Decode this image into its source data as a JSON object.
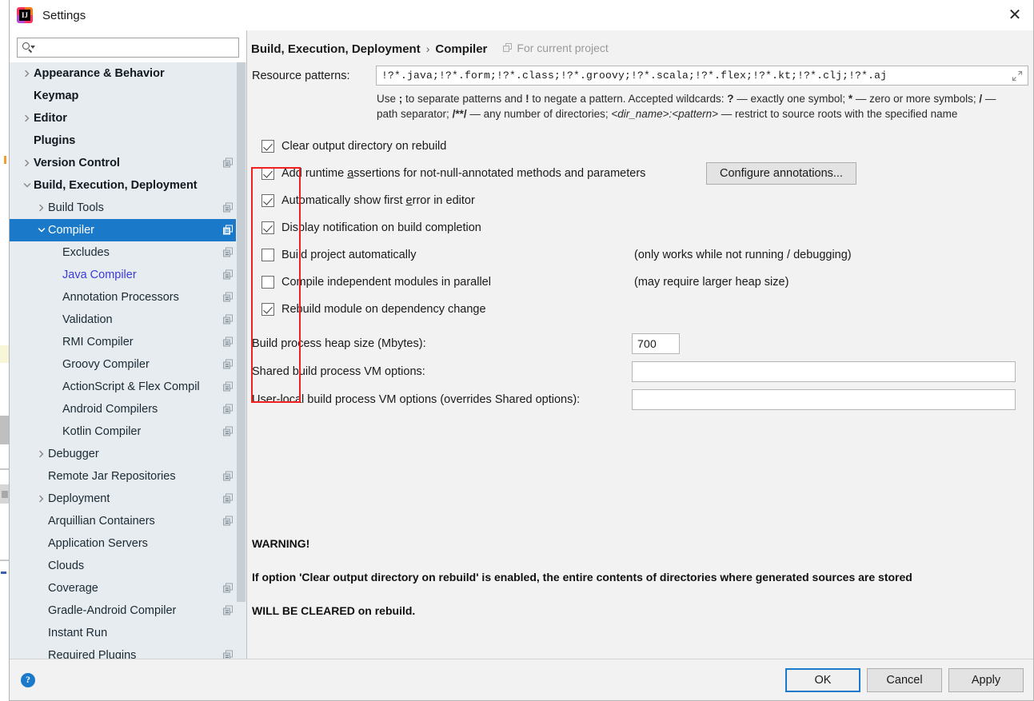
{
  "window": {
    "title": "Settings",
    "app_icon": "intellij-idea-logo",
    "close_label": "✕"
  },
  "search": {
    "value": "",
    "placeholder": ""
  },
  "sidebar": {
    "items": [
      {
        "label": "Appearance & Behavior",
        "level": 0,
        "twisty": "right",
        "bold": true,
        "copy": false,
        "selected": false,
        "link": false
      },
      {
        "label": "Keymap",
        "level": 0,
        "twisty": "none",
        "bold": true,
        "copy": false,
        "selected": false,
        "link": false
      },
      {
        "label": "Editor",
        "level": 0,
        "twisty": "right",
        "bold": true,
        "copy": false,
        "selected": false,
        "link": false
      },
      {
        "label": "Plugins",
        "level": 0,
        "twisty": "none",
        "bold": true,
        "copy": false,
        "selected": false,
        "link": false
      },
      {
        "label": "Version Control",
        "level": 0,
        "twisty": "right",
        "bold": true,
        "copy": true,
        "selected": false,
        "link": false
      },
      {
        "label": "Build, Execution, Deployment",
        "level": 0,
        "twisty": "down",
        "bold": true,
        "copy": false,
        "selected": false,
        "link": false
      },
      {
        "label": "Build Tools",
        "level": 1,
        "twisty": "right",
        "bold": false,
        "copy": true,
        "selected": false,
        "link": false
      },
      {
        "label": "Compiler",
        "level": 1,
        "twisty": "down",
        "bold": false,
        "copy": true,
        "selected": true,
        "link": false
      },
      {
        "label": "Excludes",
        "level": 2,
        "twisty": "none",
        "bold": false,
        "copy": true,
        "selected": false,
        "link": false
      },
      {
        "label": "Java Compiler",
        "level": 2,
        "twisty": "none",
        "bold": false,
        "copy": true,
        "selected": false,
        "link": true
      },
      {
        "label": "Annotation Processors",
        "level": 2,
        "twisty": "none",
        "bold": false,
        "copy": true,
        "selected": false,
        "link": false
      },
      {
        "label": "Validation",
        "level": 2,
        "twisty": "none",
        "bold": false,
        "copy": true,
        "selected": false,
        "link": false
      },
      {
        "label": "RMI Compiler",
        "level": 2,
        "twisty": "none",
        "bold": false,
        "copy": true,
        "selected": false,
        "link": false
      },
      {
        "label": "Groovy Compiler",
        "level": 2,
        "twisty": "none",
        "bold": false,
        "copy": true,
        "selected": false,
        "link": false
      },
      {
        "label": "ActionScript & Flex Compil",
        "level": 2,
        "twisty": "none",
        "bold": false,
        "copy": true,
        "selected": false,
        "link": false
      },
      {
        "label": "Android Compilers",
        "level": 2,
        "twisty": "none",
        "bold": false,
        "copy": true,
        "selected": false,
        "link": false
      },
      {
        "label": "Kotlin Compiler",
        "level": 2,
        "twisty": "none",
        "bold": false,
        "copy": true,
        "selected": false,
        "link": false
      },
      {
        "label": "Debugger",
        "level": 1,
        "twisty": "right",
        "bold": false,
        "copy": false,
        "selected": false,
        "link": false
      },
      {
        "label": "Remote Jar Repositories",
        "level": 1,
        "twisty": "none",
        "bold": false,
        "copy": true,
        "selected": false,
        "link": false
      },
      {
        "label": "Deployment",
        "level": 1,
        "twisty": "right",
        "bold": false,
        "copy": true,
        "selected": false,
        "link": false
      },
      {
        "label": "Arquillian Containers",
        "level": 1,
        "twisty": "none",
        "bold": false,
        "copy": true,
        "selected": false,
        "link": false
      },
      {
        "label": "Application Servers",
        "level": 1,
        "twisty": "none",
        "bold": false,
        "copy": false,
        "selected": false,
        "link": false
      },
      {
        "label": "Clouds",
        "level": 1,
        "twisty": "none",
        "bold": false,
        "copy": false,
        "selected": false,
        "link": false
      },
      {
        "label": "Coverage",
        "level": 1,
        "twisty": "none",
        "bold": false,
        "copy": true,
        "selected": false,
        "link": false
      },
      {
        "label": "Gradle-Android Compiler",
        "level": 1,
        "twisty": "none",
        "bold": false,
        "copy": true,
        "selected": false,
        "link": false
      },
      {
        "label": "Instant Run",
        "level": 1,
        "twisty": "none",
        "bold": false,
        "copy": false,
        "selected": false,
        "link": false
      },
      {
        "label": "Required Plugins",
        "level": 1,
        "twisty": "none",
        "bold": false,
        "copy": true,
        "selected": false,
        "link": false
      }
    ]
  },
  "breadcrumb": {
    "parent": "Build, Execution, Deployment",
    "separator": "›",
    "current": "Compiler",
    "scope": "For current project",
    "scope_icon": "copy-scope-icon"
  },
  "resource_patterns": {
    "label": "Resource patterns:",
    "value": "!?*.java;!?*.form;!?*.class;!?*.groovy;!?*.scala;!?*.flex;!?*.kt;!?*.clj;!?*.aj",
    "expand_icon": "expand-diagonal-icon"
  },
  "hint": {
    "line1_a": "Use ",
    "line1_semicolon": ";",
    "line1_b": " to separate patterns and ",
    "line1_bang": "!",
    "line1_c": " to negate a pattern. Accepted wildcards: ",
    "line1_q": "?",
    "line1_d": " — exactly one symbol; ",
    "line1_star": "*",
    "line1_e": " — zero or more symbols; ",
    "line2_slash": "/",
    "line2_a": " — path separator; ",
    "line2_globstar": "/**/",
    "line2_b": " — any number of directories; ",
    "line2_dirpattern": "<dir_name>:<pattern>",
    "line2_c": " — restrict to source roots with the specified name"
  },
  "checkboxes": [
    {
      "label": "Clear output directory on rebuild",
      "checked": true,
      "mnemonic": "",
      "note": ""
    },
    {
      "label": "Add runtime assertions for not-null-annotated methods and parameters",
      "checked": true,
      "mnemonic": "a",
      "note": ""
    },
    {
      "label": "Automatically show first error in editor",
      "checked": true,
      "mnemonic": "e",
      "note": ""
    },
    {
      "label": "Display notification on build completion",
      "checked": true,
      "mnemonic": "",
      "note": ""
    },
    {
      "label": "Build project automatically",
      "checked": false,
      "mnemonic": "",
      "note": "(only works while not running / debugging)"
    },
    {
      "label": "Compile independent modules in parallel",
      "checked": false,
      "mnemonic": "",
      "note": "(may require larger heap size)"
    },
    {
      "label": "Rebuild module on dependency change",
      "checked": true,
      "mnemonic": "",
      "note": ""
    }
  ],
  "configure_annotations_button": "Configure annotations...",
  "options": {
    "heap_label": "Build process heap size (Mbytes):",
    "heap_value": "700",
    "shared_vm_label": "Shared build process VM options:",
    "shared_vm_value": "",
    "user_vm_label": "User-local build process VM options (overrides Shared options):",
    "user_vm_value": ""
  },
  "warning": {
    "title": "WARNING!",
    "line1": "If option 'Clear output directory on rebuild' is enabled, the entire contents of directories where generated sources are stored",
    "line2": "WILL BE CLEARED on rebuild."
  },
  "footer": {
    "help": "?",
    "ok": "OK",
    "cancel": "Cancel",
    "apply": "Apply"
  },
  "annotation": {
    "color": "#f22020",
    "shape": "rectangle"
  }
}
